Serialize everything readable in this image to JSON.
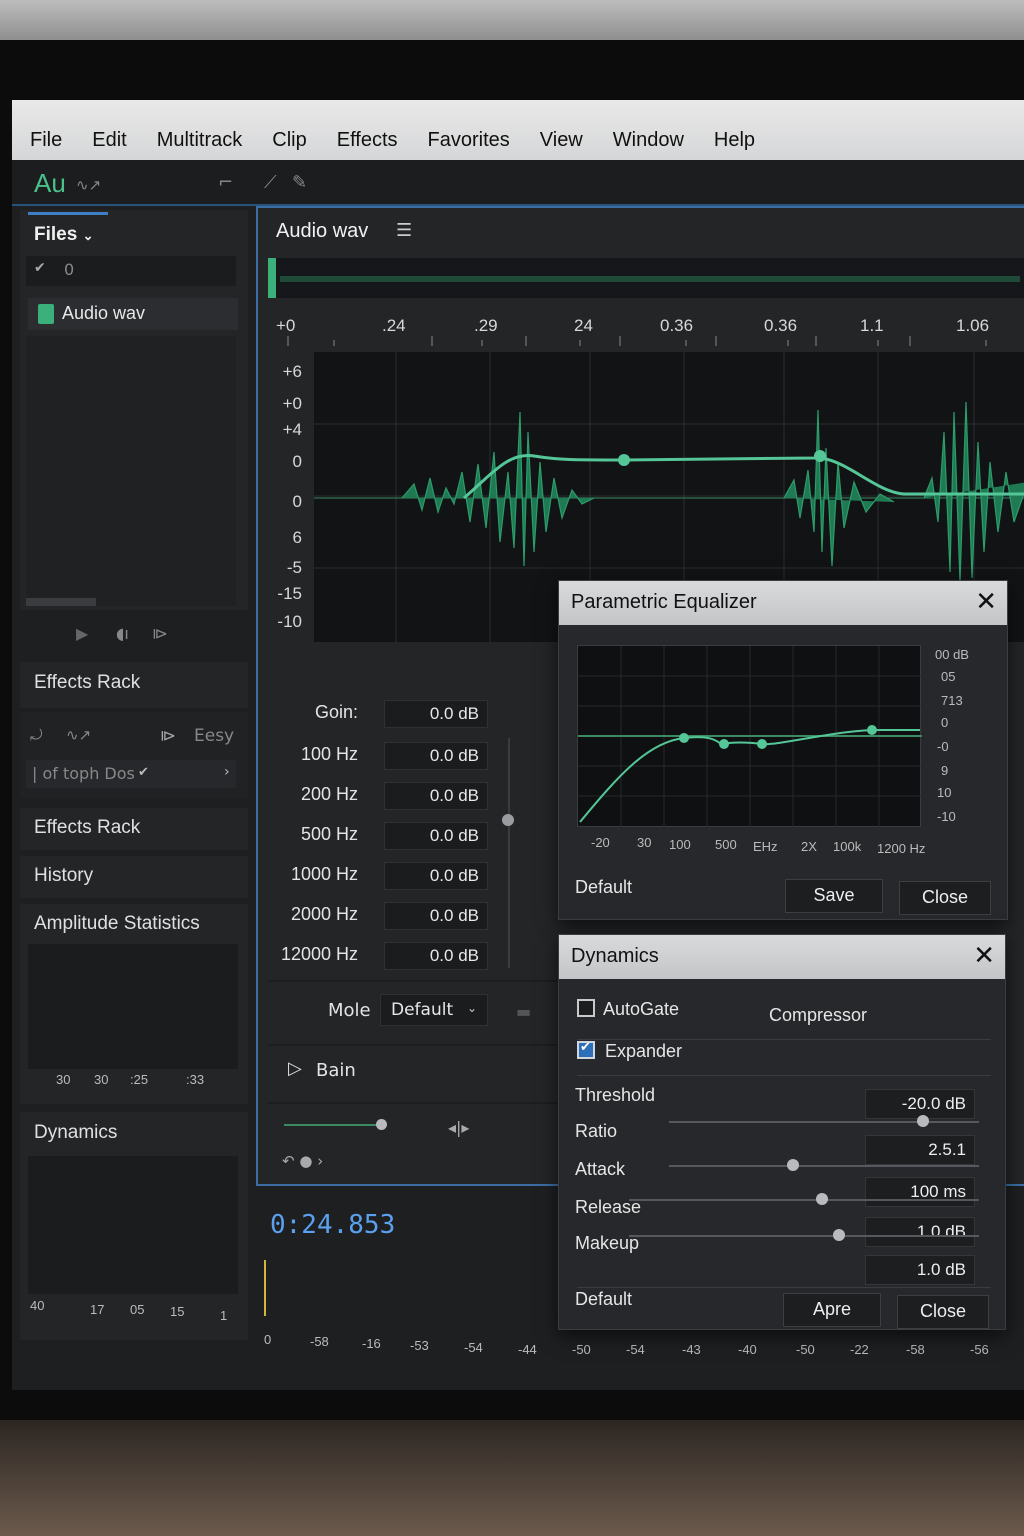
{
  "menu": [
    "File",
    "Edit",
    "Multitrack",
    "Clip",
    "Effects",
    "Favorites",
    "View",
    "Window",
    "Help"
  ],
  "app": {
    "logo": "Au"
  },
  "files_panel": {
    "tab_label": "Files",
    "filter_value": "0",
    "file_name": "Audio wav"
  },
  "effects_rack": {
    "title": "Effects Rack",
    "preset_label": "Eesy",
    "row_text": "| of toph Dos"
  },
  "left_sections": {
    "effects_rack_2": "Effects Rack",
    "history": "History",
    "amplitude_statistics": "Amplitude Statistics",
    "amp_ticks": [
      "30",
      "30",
      ":25",
      ":33"
    ],
    "dynamics": "Dynamics",
    "dyn_ticks": [
      "40",
      "17",
      "05",
      "15",
      "1"
    ]
  },
  "editor": {
    "title": "Audio wav",
    "ruler": [
      "+0",
      ".24",
      ".29",
      "24",
      "0.36",
      "0.36",
      "1.1",
      "1.06"
    ],
    "amp_scale": [
      "+6",
      "+0",
      "+4",
      "0",
      "0",
      "6",
      "-5",
      "-15",
      "-10"
    ],
    "eq_rows": [
      {
        "label": "Goin:",
        "value": "0.0 dB"
      },
      {
        "label": "100 Hz",
        "value": "0.0 dB"
      },
      {
        "label": "200 Hz",
        "value": "0.0 dB"
      },
      {
        "label": "500 Hz",
        "value": "0.0 dB"
      },
      {
        "label": "1000 Hz",
        "value": "0.0 dB"
      },
      {
        "label": "2000 Hz",
        "value": "0.0 dB"
      },
      {
        "label": "12000 Hz",
        "value": "0.0 dB"
      }
    ],
    "mode_label": "Mole",
    "mode_value": "Default",
    "play_label": "Bain"
  },
  "timecode": "0:24.853",
  "bottom_ruler": [
    "0",
    "-58",
    "-16",
    "-53",
    "-54",
    "-44",
    "-50",
    "-54",
    "-43",
    "-40",
    "-50",
    "-22",
    "-58",
    "-56"
  ],
  "param_eq": {
    "title": "Parametric Equalizer",
    "db_scale": [
      "00 dB",
      "05",
      "713",
      "0",
      "-0",
      "9",
      "10",
      "-10"
    ],
    "freq_scale": [
      "-20",
      "30",
      "100",
      "500",
      "EHz",
      "2X",
      "100k",
      "1200 Hz"
    ],
    "preset": "Default",
    "save": "Save",
    "close": "Close"
  },
  "dynamics": {
    "title": "Dynamics",
    "autogate": "AutoGate",
    "compressor": "Compressor",
    "expander": "Expander",
    "autogate_checked": false,
    "expander_checked": true,
    "params": [
      {
        "label": "Threshold",
        "value": "-20.0 dB",
        "level": 0.82
      },
      {
        "label": "Ratio",
        "value": "2.5.1",
        "level": 0.4
      },
      {
        "label": "Attack",
        "value": "100 ms",
        "level": 0.55
      },
      {
        "label": "Release",
        "value": "1.0 dB",
        "level": 0.6
      },
      {
        "label": "Makeup",
        "value": "1.0 dB",
        "level": 0.5
      }
    ],
    "preset": "Default",
    "apply": "Apre",
    "close": "Close"
  },
  "colors": {
    "accent": "#3bb07a",
    "selection": "#3a6ea5",
    "timecode": "#5aa0ee"
  }
}
